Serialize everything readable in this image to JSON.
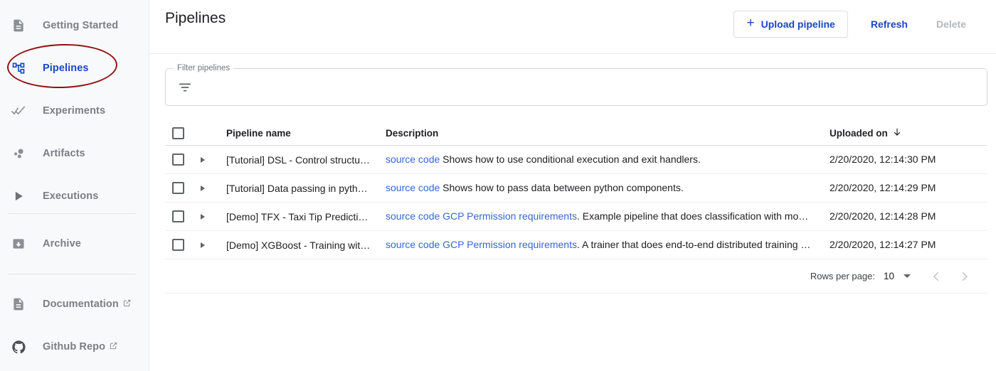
{
  "sidebar": {
    "items": [
      {
        "label": "Getting Started",
        "icon": "description-icon",
        "active": false,
        "external": false
      },
      {
        "label": "Pipelines",
        "icon": "account-tree-icon",
        "active": true,
        "external": false
      },
      {
        "label": "Experiments",
        "icon": "double-check-icon",
        "active": false,
        "external": false
      },
      {
        "label": "Artifacts",
        "icon": "bubble-chart-icon",
        "active": false,
        "external": false
      },
      {
        "label": "Executions",
        "icon": "play-arrow-icon",
        "active": false,
        "external": false
      }
    ],
    "bottom_items": [
      {
        "label": "Archive",
        "icon": "archive-icon",
        "external": false
      },
      {
        "label": "Documentation",
        "icon": "description-icon",
        "external": true
      },
      {
        "label": "Github Repo",
        "icon": "github-icon",
        "external": true
      }
    ]
  },
  "annotation": {
    "shape": "ellipse",
    "color": "#8f1111",
    "target": "sidebar-item-pipelines"
  },
  "header": {
    "title": "Pipelines",
    "upload_label": "Upload pipeline",
    "upload_icon": "plus-icon",
    "refresh_label": "Refresh",
    "delete_label": "Delete"
  },
  "filter": {
    "legend": "Filter pipelines",
    "value": "",
    "placeholder": "",
    "icon": "filter-list-icon"
  },
  "table": {
    "columns": {
      "name": "Pipeline name",
      "description": "Description",
      "uploaded_on": "Uploaded on",
      "sort_icon": "arrow-downward-icon"
    },
    "rows": [
      {
        "name": "[Tutorial] DSL - Control structu…",
        "links": [
          "source code"
        ],
        "description": "Shows how to use conditional execution and exit handlers.",
        "uploaded_on": "2/20/2020, 12:14:30 PM"
      },
      {
        "name": "[Tutorial] Data passing in pyth…",
        "links": [
          "source code"
        ],
        "description": "Shows how to pass data between python components.",
        "uploaded_on": "2/20/2020, 12:14:29 PM"
      },
      {
        "name": "[Demo] TFX - Taxi Tip Predicti…",
        "links": [
          "source code",
          "GCP Permission requirements"
        ],
        "description": ". Example pipeline that does classification with mo…",
        "uploaded_on": "2/20/2020, 12:14:28 PM"
      },
      {
        "name": "[Demo] XGBoost - Training wit…",
        "links": [
          "source code",
          "GCP Permission requirements"
        ],
        "description": ". A trainer that does end-to-end distributed training …",
        "uploaded_on": "2/20/2020, 12:14:27 PM"
      }
    ]
  },
  "pagination": {
    "rows_per_page_label": "Rows per page:",
    "rows_per_page_value": "10",
    "prev_icon": "chevron-left-icon",
    "next_icon": "chevron-right-icon"
  },
  "colors": {
    "accent_blue": "#1a46c9",
    "link_blue": "#3367d6",
    "muted_text": "#7a7f85",
    "annotation_red": "#8f1111"
  }
}
